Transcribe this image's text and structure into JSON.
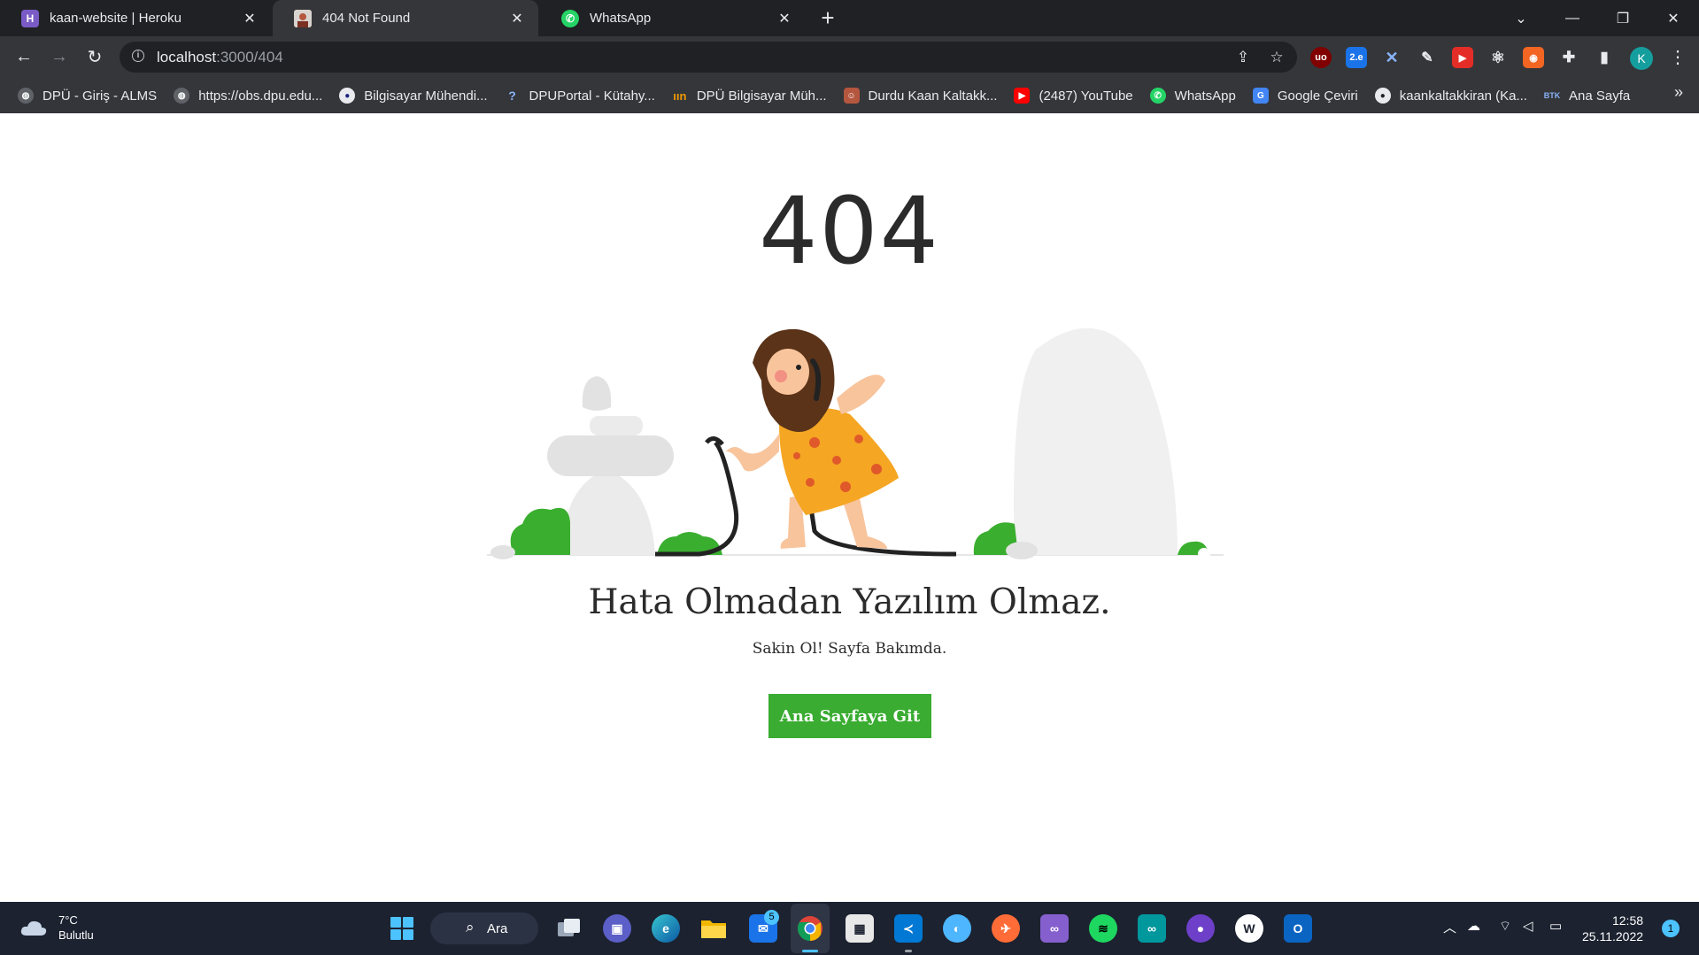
{
  "browser": {
    "tabs": [
      {
        "title": "kaan-website | Heroku",
        "favicon": "heroku-icon",
        "active": false
      },
      {
        "title": "404 Not Found",
        "favicon": "avatar-icon",
        "active": true
      },
      {
        "title": "WhatsApp",
        "favicon": "whatsapp-icon",
        "active": false
      }
    ],
    "url_host": "localhost",
    "url_path": ":3000/404",
    "profile_initial": "K",
    "bookmarks": [
      {
        "label": "DPÜ - Giriş - ALMS",
        "icon": "globe-icon"
      },
      {
        "label": "https://obs.dpu.edu...",
        "icon": "globe-icon"
      },
      {
        "label": "Bilgisayar Mühendi...",
        "icon": "dpu-icon"
      },
      {
        "label": "DPUPortal - Kütahy...",
        "icon": "dpuportal-icon"
      },
      {
        "label": "DPÜ Bilgisayar Müh...",
        "icon": "dpu-orange-icon"
      },
      {
        "label": "Durdu Kaan Kaltakk...",
        "icon": "avatar-icon"
      },
      {
        "label": "(2487) YouTube",
        "icon": "youtube-icon"
      },
      {
        "label": "WhatsApp",
        "icon": "whatsapp-icon"
      },
      {
        "label": "Google Çeviri",
        "icon": "google-translate-icon"
      },
      {
        "label": "kaankaltakkiran (Ka...",
        "icon": "github-icon"
      },
      {
        "label": "Ana Sayfa",
        "icon": "btk-icon"
      }
    ]
  },
  "page": {
    "error_code": "404",
    "headline": "Hata Olmadan Yazılım Olmaz.",
    "subline": "Sakin Ol! Sayfa Bakımda.",
    "button_label": "Ana Sayfaya Git",
    "accent_color": "#39ac31"
  },
  "taskbar": {
    "weather_temp": "7°C",
    "weather_desc": "Bulutlu",
    "search_label": "Ara",
    "mail_badge": "5",
    "time": "12:58",
    "date": "25.11.2022",
    "notification_count": "1"
  }
}
